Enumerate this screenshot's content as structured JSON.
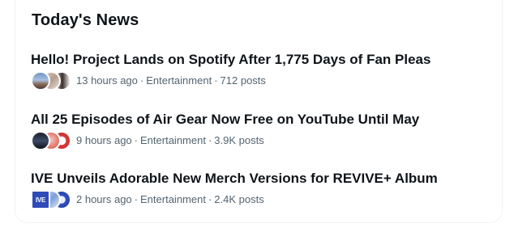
{
  "section": {
    "title": "Today's News"
  },
  "news": [
    {
      "headline": "Hello! Project Lands on Spotify After 1,775 Days of Fan Pleas",
      "time": "13 hours ago",
      "category": "Entertainment",
      "posts": "712 posts",
      "avatar_icons": [
        "landscape-photo-avatar-icon",
        "group-photo-avatar-icon",
        "person-photo-avatar-icon"
      ]
    },
    {
      "headline": "All 25 Episodes of Air Gear Now Free on YouTube Until May",
      "time": "9 hours ago",
      "category": "Entertainment",
      "posts": "3.9K posts",
      "avatar_icons": [
        "dark-anime-avatar-icon",
        "pink-avatar-icon",
        "red-logo-avatar-icon"
      ]
    },
    {
      "headline": "IVE Unveils Adorable New Merch Versions for REVIVE+ Album",
      "time": "2 hours ago",
      "category": "Entertainment",
      "posts": "2.4K posts",
      "avatar_logo_text": "IVE",
      "avatar_icons": [
        "ive-logo-avatar-icon",
        "blue-photo-avatar-icon",
        "ive-blue-avatar-icon"
      ]
    }
  ],
  "separator": "·",
  "colors": {
    "accent": "#1d9bf0",
    "text": "#0f1419",
    "secondary_text": "#536471",
    "border": "#eff3f4"
  }
}
